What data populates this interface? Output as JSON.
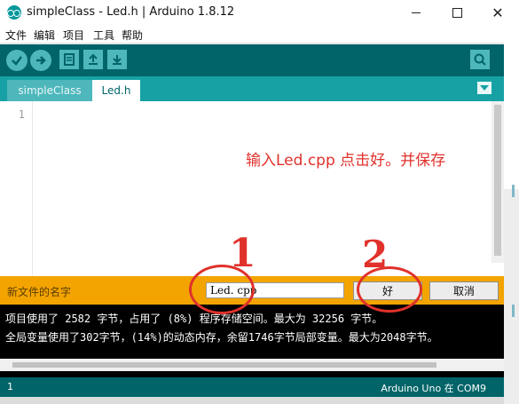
{
  "window": {
    "title": "simpleClass - Led.h | Arduino 1.8.12",
    "min_symbol": "",
    "max_symbol": "",
    "close_symbol": "✕"
  },
  "menu": {
    "items": [
      "文件",
      "编辑",
      "项目",
      "工具",
      "帮助"
    ]
  },
  "toolbar": {
    "buttons": [
      "check-icon",
      "arrow-right-icon",
      "new-file-icon",
      "upload-icon",
      "download-icon"
    ],
    "serial_monitor_icon": "magnifier-icon"
  },
  "tabs": {
    "items": [
      "simpleClass",
      "Led.h"
    ],
    "active": "Led.h"
  },
  "editor": {
    "line_number": "1",
    "instruction_text": "输入Led.cpp 点击好。并保存",
    "annotation_1": "1",
    "annotation_2": "2"
  },
  "new_file_prompt": {
    "label": "新文件的名字",
    "input_value": "Led. cpp",
    "ok_label": "好",
    "cancel_label": "取消"
  },
  "console": {
    "line1": "项目使用了 2582 字节，占用了 (8%) 程序存储空间。最大为 32256 字节。",
    "line2": "全局变量使用了302字节，(14%)的动态内存，余留1746字节局部变量。最大为2048字节。"
  },
  "status": {
    "line": "1",
    "board": "Arduino Uno 在 COM9"
  },
  "colors": {
    "toolbar": "#006468",
    "tabs_bar": "#17a1a5",
    "prompt_bar": "#f3a400",
    "annotation_red": "#e0312b"
  }
}
